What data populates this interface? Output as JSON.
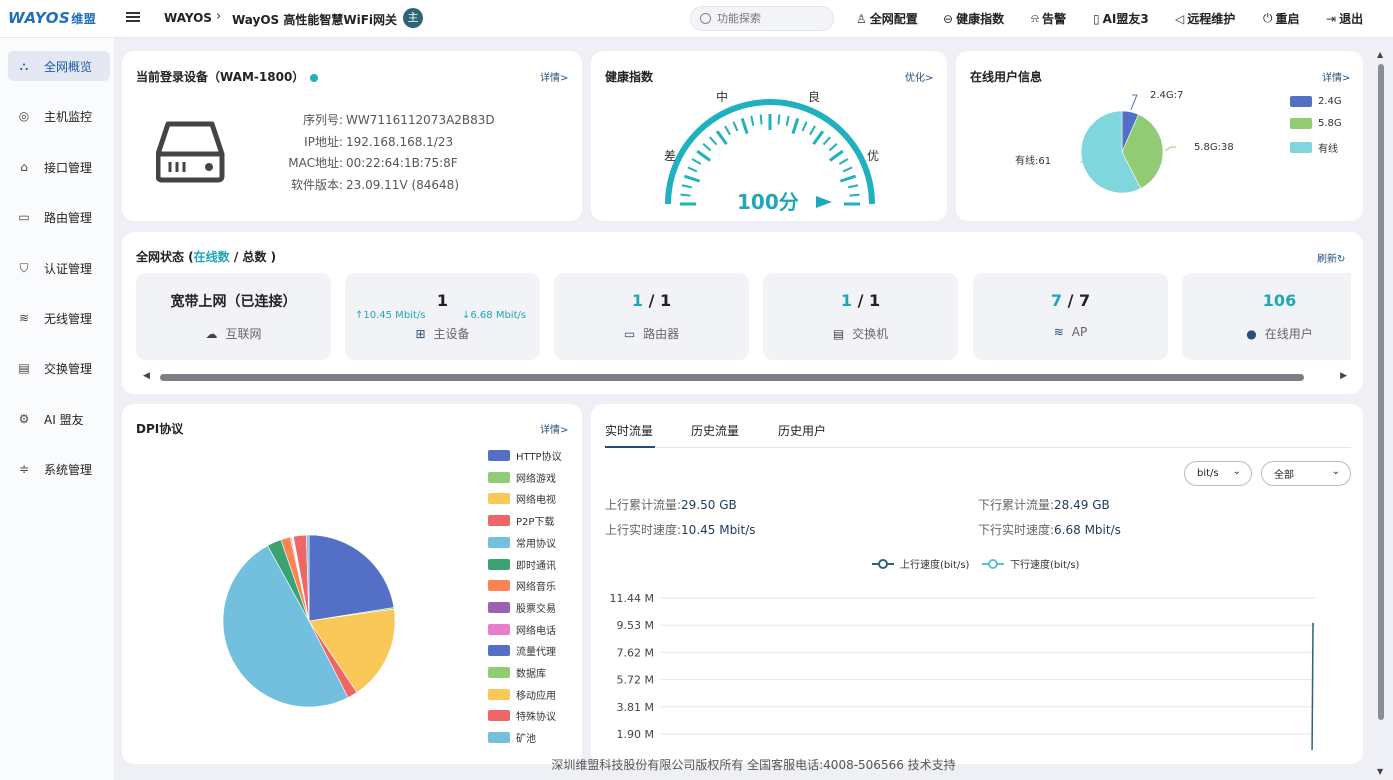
{
  "header": {
    "logo": "WAYOS",
    "logo_cn": "维盟",
    "breadcrumb_root": "WAYOS",
    "breadcrumb_current": "WayOS 高性能智慧WiFi网关",
    "badge": "主",
    "search_placeholder": "功能探索",
    "nav": [
      {
        "label": "全网配置",
        "icon": "rocket-icon"
      },
      {
        "label": "健康指数",
        "icon": "health-icon"
      },
      {
        "label": "告警",
        "icon": "alarm-icon"
      },
      {
        "label": "AI盟友3",
        "icon": "phone-icon"
      },
      {
        "label": "远程维护",
        "icon": "send-icon"
      },
      {
        "label": "重启",
        "icon": "power-icon"
      },
      {
        "label": "退出",
        "icon": "logout-icon"
      }
    ]
  },
  "sidebar": {
    "items": [
      {
        "label": "全网概览",
        "icon": "network-icon",
        "active": true
      },
      {
        "label": "主机监控",
        "icon": "user-icon"
      },
      {
        "label": "接口管理",
        "icon": "interface-icon"
      },
      {
        "label": "路由管理",
        "icon": "router-icon"
      },
      {
        "label": "认证管理",
        "icon": "shield-icon"
      },
      {
        "label": "无线管理",
        "icon": "wifi-icon"
      },
      {
        "label": "交换管理",
        "icon": "switch-icon"
      },
      {
        "label": "AI 盟友",
        "icon": "ai-icon"
      },
      {
        "label": "系统管理",
        "icon": "sliders-icon"
      }
    ]
  },
  "device": {
    "title": "当前登录设备（WAM-1800）",
    "more": "详情>",
    "fields": [
      {
        "k": "序列号:",
        "v": "WW7116112073A2B83D"
      },
      {
        "k": "IP地址:",
        "v": "192.168.168.1/23"
      },
      {
        "k": "MAC地址:",
        "v": "00:22:64:1B:75:8F"
      },
      {
        "k": "软件版本:",
        "v": "23.09.11V (84648)"
      }
    ]
  },
  "health": {
    "title": "健康指数",
    "more": "优化>",
    "labels": [
      "差",
      "中",
      "良",
      "优"
    ],
    "score": "100分",
    "value": 100
  },
  "online_users": {
    "title": "在线用户信息",
    "more": "详情>",
    "slices": [
      {
        "name": "2.4G",
        "value": 7,
        "color": "#5470c6",
        "label": "2.4G:7"
      },
      {
        "name": "5.8G",
        "value": 38,
        "color": "#91cc75",
        "label": "5.8G:38"
      },
      {
        "name": "有线",
        "value": 61,
        "color": "#7fd6dc",
        "label": "有线:61"
      }
    ]
  },
  "network_status": {
    "title_prefix": "全网状态 (",
    "title_online": "在线数",
    "title_suffix": " / 总数 )",
    "refresh": "刷新",
    "boxes": [
      {
        "num_main": "宽带上网（已连接）",
        "label": "互联网",
        "icon": "cloud-icon"
      },
      {
        "num_main": "1",
        "up": "↑10.45 Mbit/s",
        "down": "↓6.68 Mbit/s",
        "label": "主设备",
        "icon": "device-icon"
      },
      {
        "online": "1",
        "sep": " / ",
        "total": "1",
        "label": "路由器",
        "icon": "router-icon"
      },
      {
        "online": "1",
        "sep": " / ",
        "total": "1",
        "label": "交换机",
        "icon": "switch-icon"
      },
      {
        "online": "7",
        "sep": " / ",
        "total": "7",
        "label": "AP",
        "icon": "wifi-icon"
      },
      {
        "online": "106",
        "label": "在线用户",
        "icon": "person-icon"
      }
    ]
  },
  "dpi": {
    "title": "DPI协议",
    "more": "详情>",
    "legend": [
      {
        "name": "HTTP协议",
        "color": "#5470c6"
      },
      {
        "name": "网络游戏",
        "color": "#91cc75"
      },
      {
        "name": "网络电视",
        "color": "#fac858"
      },
      {
        "name": "P2P下载",
        "color": "#ee6666"
      },
      {
        "name": "常用协议",
        "color": "#73c0de"
      },
      {
        "name": "即时通讯",
        "color": "#3ba272"
      },
      {
        "name": "网络音乐",
        "color": "#fc8452"
      },
      {
        "name": "股票交易",
        "color": "#9a60b4"
      },
      {
        "name": "网络电话",
        "color": "#ea7ccc"
      },
      {
        "name": "流量代理",
        "color": "#5470c6"
      },
      {
        "name": "数据库",
        "color": "#91cc75"
      },
      {
        "name": "移动应用",
        "color": "#fac858"
      },
      {
        "name": "特殊协议",
        "color": "#ee6666"
      },
      {
        "name": "矿池",
        "color": "#73c0de"
      }
    ]
  },
  "traffic": {
    "tabs": [
      "实时流量",
      "历史流量",
      "历史用户"
    ],
    "unit_select": "bit/s",
    "scope_select": "全部",
    "up_total_label": "上行累计流量:",
    "up_total": "29.50 GB",
    "down_total_label": "下行累计流量:",
    "down_total": "28.49 GB",
    "up_speed_label": "上行实时速度:",
    "up_speed": "10.45 Mbit/s",
    "down_speed_label": "下行实时速度:",
    "down_speed": "6.68 Mbit/s"
  },
  "chart_data": [
    {
      "type": "pie",
      "categories": [
        "2.4G",
        "5.8G",
        "有线"
      ],
      "values": [
        7,
        38,
        61
      ]
    },
    {
      "type": "pie",
      "categories": [
        "HTTP协议",
        "网络游戏",
        "网络电视",
        "P2P下载",
        "常用协议",
        "即时通讯",
        "网络音乐",
        "股票交易",
        "网络电话",
        "流量代理",
        "数据库",
        "移动应用",
        "特殊协议",
        "矿池"
      ],
      "values": [
        22.5,
        0.3,
        17.8,
        1.9,
        49.5,
        2.7,
        1.8,
        0.2,
        0.1,
        0.1,
        0.1,
        0.1,
        2.4,
        0.5
      ],
      "colors": [
        "#5470c6",
        "#91cc75",
        "#fac858",
        "#ee6666",
        "#73c0de",
        "#3ba272",
        "#fc8452",
        "#9a60b4",
        "#ea7ccc",
        "#5470c6",
        "#91cc75",
        "#fac858",
        "#ee6666",
        "#73c0de"
      ]
    },
    {
      "type": "line",
      "series": [
        {
          "name": "上行速度(bit/s)",
          "color": "#2d6478"
        },
        {
          "name": "下行速度(bit/s)",
          "color": "#5fc3c7"
        }
      ],
      "y_ticks": [
        "11.44 M",
        "9.53 M",
        "7.62 M",
        "5.72 M",
        "3.81 M",
        "1.90 M"
      ],
      "ylim": [
        0,
        11.44
      ]
    }
  ],
  "footer": {
    "text": "深圳维盟科技股份有限公司版权所有   全国客服电话:4008-506566   技术支持"
  }
}
